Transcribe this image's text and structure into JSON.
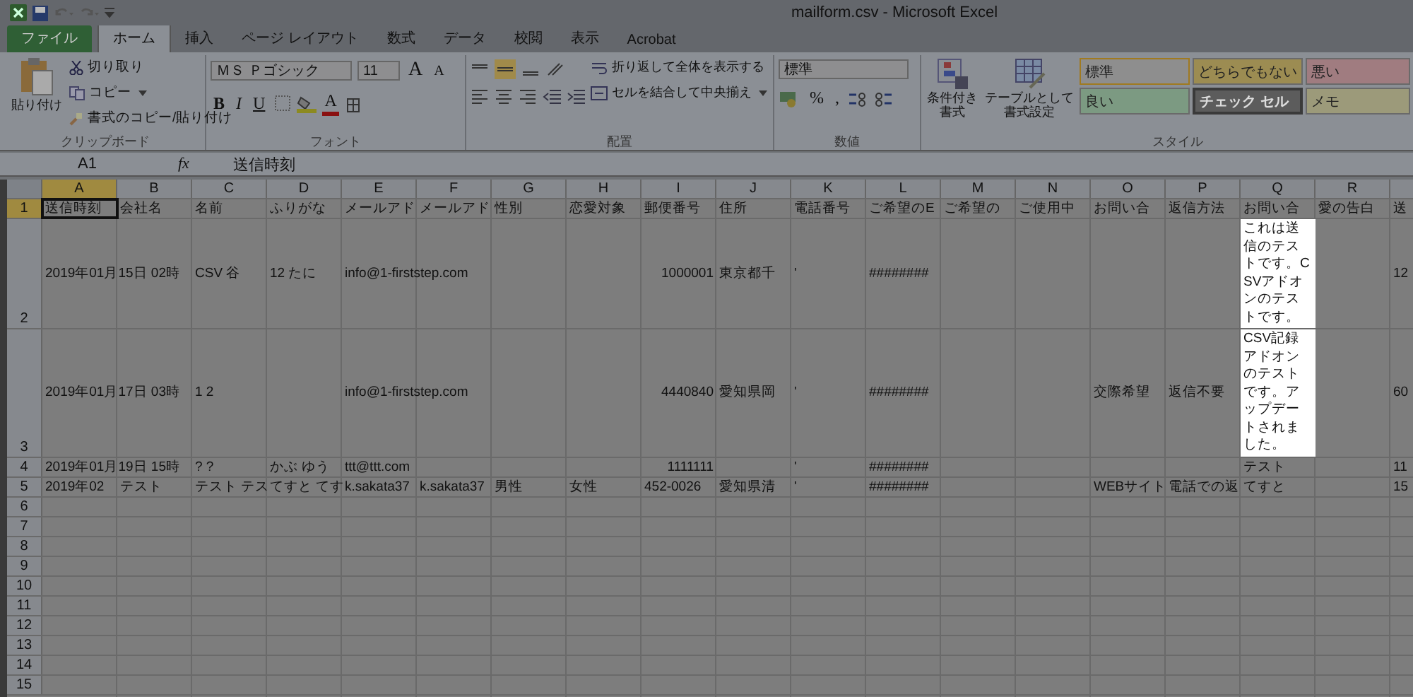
{
  "window": {
    "title": "mailform.csv - Microsoft Excel"
  },
  "tabs": [
    {
      "label": "ファイル",
      "kind": "file",
      "selected": false
    },
    {
      "label": "ホーム",
      "kind": "tab",
      "selected": true
    },
    {
      "label": "挿入",
      "kind": "tab",
      "selected": false
    },
    {
      "label": "ページ レイアウト",
      "kind": "tab",
      "selected": false
    },
    {
      "label": "数式",
      "kind": "tab",
      "selected": false
    },
    {
      "label": "データ",
      "kind": "tab",
      "selected": false
    },
    {
      "label": "校閲",
      "kind": "tab",
      "selected": false
    },
    {
      "label": "表示",
      "kind": "tab",
      "selected": false
    },
    {
      "label": "Acrobat",
      "kind": "tab",
      "selected": false
    }
  ],
  "ribbon": {
    "clipboard": {
      "paste": "貼り付け",
      "cut": "切り取り",
      "copy": "コピー",
      "format_painter": "書式のコピー/貼り付け",
      "label": "クリップボード"
    },
    "font": {
      "name": "ＭＳ Ｐゴシック",
      "size": "11",
      "grow": "A",
      "shrink": "A",
      "bold": "B",
      "italic": "I",
      "underline": "U",
      "font_color": "A",
      "label": "フォント"
    },
    "alignment": {
      "wrap": "折り返して全体を表示する",
      "merge": "セルを結合して中央揃え",
      "label": "配置"
    },
    "number": {
      "format": "標準",
      "percent": "%",
      "comma": ",",
      "label": "数値"
    },
    "styles": {
      "conditional": [
        "条件付き",
        "書式"
      ],
      "table": [
        "テーブルとして",
        "書式設定"
      ],
      "label": "スタイル",
      "cells": [
        {
          "label": "標準",
          "color": "#8e8e8e",
          "kind": "light",
          "selected": true
        },
        {
          "label": "どちらでもない",
          "color": "#9c8c52",
          "kind": "light",
          "selected": false
        },
        {
          "label": "悪い",
          "color": "#a07c80",
          "kind": "light",
          "selected": false
        },
        {
          "label": "良い",
          "color": "#7c9a82",
          "kind": "light",
          "selected": false
        },
        {
          "label": "チェック セル",
          "color": "#5c5c5c",
          "kind": "dark",
          "selected": false
        },
        {
          "label": "メモ",
          "color": "#9c9a7a",
          "kind": "light",
          "selected": false
        }
      ]
    }
  },
  "formula_bar": {
    "name_box": "A1",
    "function_label": "fx",
    "value": "送信時刻"
  },
  "sheet": {
    "columns": [
      {
        "label": "A",
        "selected": true
      },
      {
        "label": "B",
        "selected": false
      },
      {
        "label": "C",
        "selected": false
      },
      {
        "label": "D",
        "selected": false
      },
      {
        "label": "E",
        "selected": false
      },
      {
        "label": "F",
        "selected": false
      },
      {
        "label": "G",
        "selected": false
      },
      {
        "label": "H",
        "selected": false
      },
      {
        "label": "I",
        "selected": false
      },
      {
        "label": "J",
        "selected": false
      },
      {
        "label": "K",
        "selected": false
      },
      {
        "label": "L",
        "selected": false
      },
      {
        "label": "M",
        "selected": false
      },
      {
        "label": "N",
        "selected": false
      },
      {
        "label": "O",
        "selected": false
      },
      {
        "label": "P",
        "selected": false
      },
      {
        "label": "Q",
        "selected": false
      },
      {
        "label": "R",
        "selected": false
      }
    ],
    "rows": [
      {
        "header": "1",
        "selected": true,
        "cells": [
          {
            "text": "送信時刻",
            "kind": "text"
          },
          {
            "text": "会社名",
            "kind": "text"
          },
          {
            "text": "名前",
            "kind": "text"
          },
          {
            "text": "ふりがな",
            "kind": "text"
          },
          {
            "text": "メールアド",
            "kind": "text"
          },
          {
            "text": "メールアド",
            "kind": "text"
          },
          {
            "text": "性別",
            "kind": "text"
          },
          {
            "text": "恋愛対象",
            "kind": "text"
          },
          {
            "text": "郵便番号",
            "kind": "text"
          },
          {
            "text": "住所",
            "kind": "text"
          },
          {
            "text": "電話番号",
            "kind": "text"
          },
          {
            "text": "ご希望のE",
            "kind": "text"
          },
          {
            "text": "ご希望の",
            "kind": "text"
          },
          {
            "text": "ご使用中",
            "kind": "text"
          },
          {
            "text": "お問い合",
            "kind": "text"
          },
          {
            "text": "返信方法",
            "kind": "text"
          },
          {
            "text": "お問い合",
            "kind": "text"
          },
          {
            "text": "愛の告白",
            "kind": "text"
          },
          {
            "text": "送",
            "kind": "text"
          }
        ]
      },
      {
        "header": "2",
        "selected": false,
        "cells": [
          {
            "text": "2019年01月15日 02時",
            "kind": "text"
          },
          {
            "kind": "empty"
          },
          {
            "text": "CSV 谷",
            "kind": "text"
          },
          {
            "text": "12 たに",
            "kind": "text"
          },
          {
            "text": "info@1-firststep.com",
            "kind": "text"
          },
          {
            "kind": "empty"
          },
          {
            "kind": "empty"
          },
          {
            "kind": "empty"
          },
          {
            "text": "1000001",
            "kind": "number"
          },
          {
            "text": "東京都千",
            "kind": "text"
          },
          {
            "text": "'",
            "kind": "text"
          },
          {
            "text": "########",
            "kind": "text"
          },
          {
            "kind": "empty"
          },
          {
            "kind": "empty"
          },
          {
            "kind": "empty"
          },
          {
            "kind": "empty"
          },
          {
            "text": "これは送信のテストです。CSVアドオンのテストです。",
            "kind": "highlighted"
          },
          {
            "kind": "empty"
          },
          {
            "text": "12",
            "kind": "text"
          }
        ]
      },
      {
        "header": "3",
        "selected": false,
        "cells": [
          {
            "text": "2019年01月17日 03時",
            "kind": "text"
          },
          {
            "kind": "empty"
          },
          {
            "text": "1 2",
            "kind": "text"
          },
          {
            "kind": "empty"
          },
          {
            "text": "info@1-firststep.com",
            "kind": "text"
          },
          {
            "kind": "empty"
          },
          {
            "kind": "empty"
          },
          {
            "kind": "empty"
          },
          {
            "text": "4440840",
            "kind": "number"
          },
          {
            "text": "愛知県岡",
            "kind": "text"
          },
          {
            "text": "'",
            "kind": "text"
          },
          {
            "text": "########",
            "kind": "text"
          },
          {
            "kind": "empty"
          },
          {
            "kind": "empty"
          },
          {
            "text": "交際希望",
            "kind": "text"
          },
          {
            "text": "返信不要",
            "kind": "text"
          },
          {
            "text": "CSV記録アドオンのテストです。アップデートされました。",
            "kind": "highlighted"
          },
          {
            "kind": "empty"
          },
          {
            "text": "60",
            "kind": "text"
          }
        ]
      },
      {
        "header": "4",
        "selected": false,
        "cells": [
          {
            "text": "2019年01月19日 15時",
            "kind": "text"
          },
          {
            "kind": "empty"
          },
          {
            "text": "? ?",
            "kind": "text"
          },
          {
            "text": "かぶ ゆう",
            "kind": "text"
          },
          {
            "text": "ttt@ttt.com",
            "kind": "text"
          },
          {
            "kind": "empty"
          },
          {
            "kind": "empty"
          },
          {
            "kind": "empty"
          },
          {
            "text": "1111111",
            "kind": "number"
          },
          {
            "kind": "empty"
          },
          {
            "text": "'",
            "kind": "text"
          },
          {
            "text": "########",
            "kind": "text"
          },
          {
            "kind": "empty"
          },
          {
            "kind": "empty"
          },
          {
            "kind": "empty"
          },
          {
            "kind": "empty"
          },
          {
            "text": "テスト",
            "kind": "text"
          },
          {
            "kind": "empty"
          },
          {
            "text": "11",
            "kind": "text"
          }
        ]
      },
      {
        "header": "5",
        "selected": false,
        "cells": [
          {
            "text": "2019年02",
            "kind": "text"
          },
          {
            "text": "テスト",
            "kind": "text"
          },
          {
            "text": "テスト テス",
            "kind": "text"
          },
          {
            "text": "てすと てす",
            "kind": "text"
          },
          {
            "text": "k.sakata37",
            "kind": "text"
          },
          {
            "text": "k.sakata37",
            "kind": "text"
          },
          {
            "text": "男性",
            "kind": "text"
          },
          {
            "text": "女性",
            "kind": "text"
          },
          {
            "text": "452-0026",
            "kind": "text"
          },
          {
            "text": "愛知県清",
            "kind": "text"
          },
          {
            "text": "'",
            "kind": "text"
          },
          {
            "text": "########",
            "kind": "text"
          },
          {
            "kind": "empty"
          },
          {
            "kind": "empty"
          },
          {
            "text": "WEBサイト",
            "kind": "text"
          },
          {
            "text": "電話での返",
            "kind": "text"
          },
          {
            "text": "てすと",
            "kind": "text"
          },
          {
            "kind": "empty"
          },
          {
            "text": "15",
            "kind": "text"
          }
        ]
      },
      {
        "header": "6",
        "selected": false,
        "cells": []
      },
      {
        "header": "7",
        "selected": false,
        "cells": []
      },
      {
        "header": "8",
        "selected": false,
        "cells": []
      },
      {
        "header": "9",
        "selected": false,
        "cells": []
      },
      {
        "header": "10",
        "selected": false,
        "cells": []
      },
      {
        "header": "11",
        "selected": false,
        "cells": []
      },
      {
        "header": "12",
        "selected": false,
        "cells": []
      },
      {
        "header": "13",
        "selected": false,
        "cells": []
      },
      {
        "header": "14",
        "selected": false,
        "cells": []
      },
      {
        "header": "15",
        "selected": false,
        "cells": []
      }
    ]
  }
}
